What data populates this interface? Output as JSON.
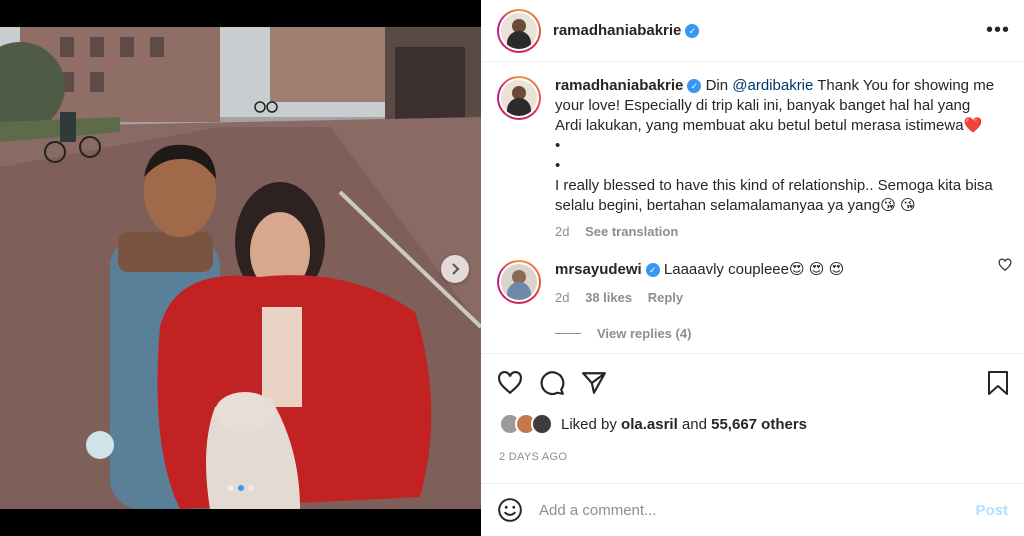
{
  "post": {
    "username": "ramadhaniabakrie",
    "verified_icon": "verified-badge-icon",
    "more_icon": "more-options-icon",
    "more_label": "•••"
  },
  "caption": {
    "username": "ramadhaniabakrie",
    "prefix": "Din ",
    "mention": "@ardibakrie",
    "text_1": " Thank You for showing me your love! Especially di trip kali ini, banyak banget hal hal yang Ardi lakukan, yang membuat aku betul betul merasa istimewa❤️",
    "bullet_1": "•",
    "bullet_2": "•",
    "text_2": "I really blessed to have this kind of relationship.. Semoga kita bisa selalu begini, bertahan selamalamanyaa ya yang😘 😘",
    "age": "2d",
    "see_translation": "See translation"
  },
  "comments": [
    {
      "username": "mrsayudewi",
      "text": "Laaaavly coupleee😍 😍 😍",
      "age": "2d",
      "likes": "38 likes",
      "reply": "Reply",
      "view_replies": "View replies (4)"
    }
  ],
  "actions": {
    "like_icon": "heart-icon",
    "comment_icon": "comment-icon",
    "share_icon": "share-icon",
    "save_icon": "bookmark-icon"
  },
  "likes": {
    "prefix": "Liked by ",
    "user": "ola.asril",
    "middle": " and ",
    "others": "55,667 others"
  },
  "time_ago": "2 DAYS AGO",
  "comment_input": {
    "placeholder": "Add a comment...",
    "emoji_icon": "emoji-icon",
    "post_label": "Post"
  },
  "carousel": {
    "next_icon": "chevron-right-icon",
    "current_index": 1,
    "count": 3
  },
  "colors": {
    "accent_blue": "#3897f0",
    "post_disabled": "#b2dffc",
    "heart_red": "#ed4956"
  }
}
